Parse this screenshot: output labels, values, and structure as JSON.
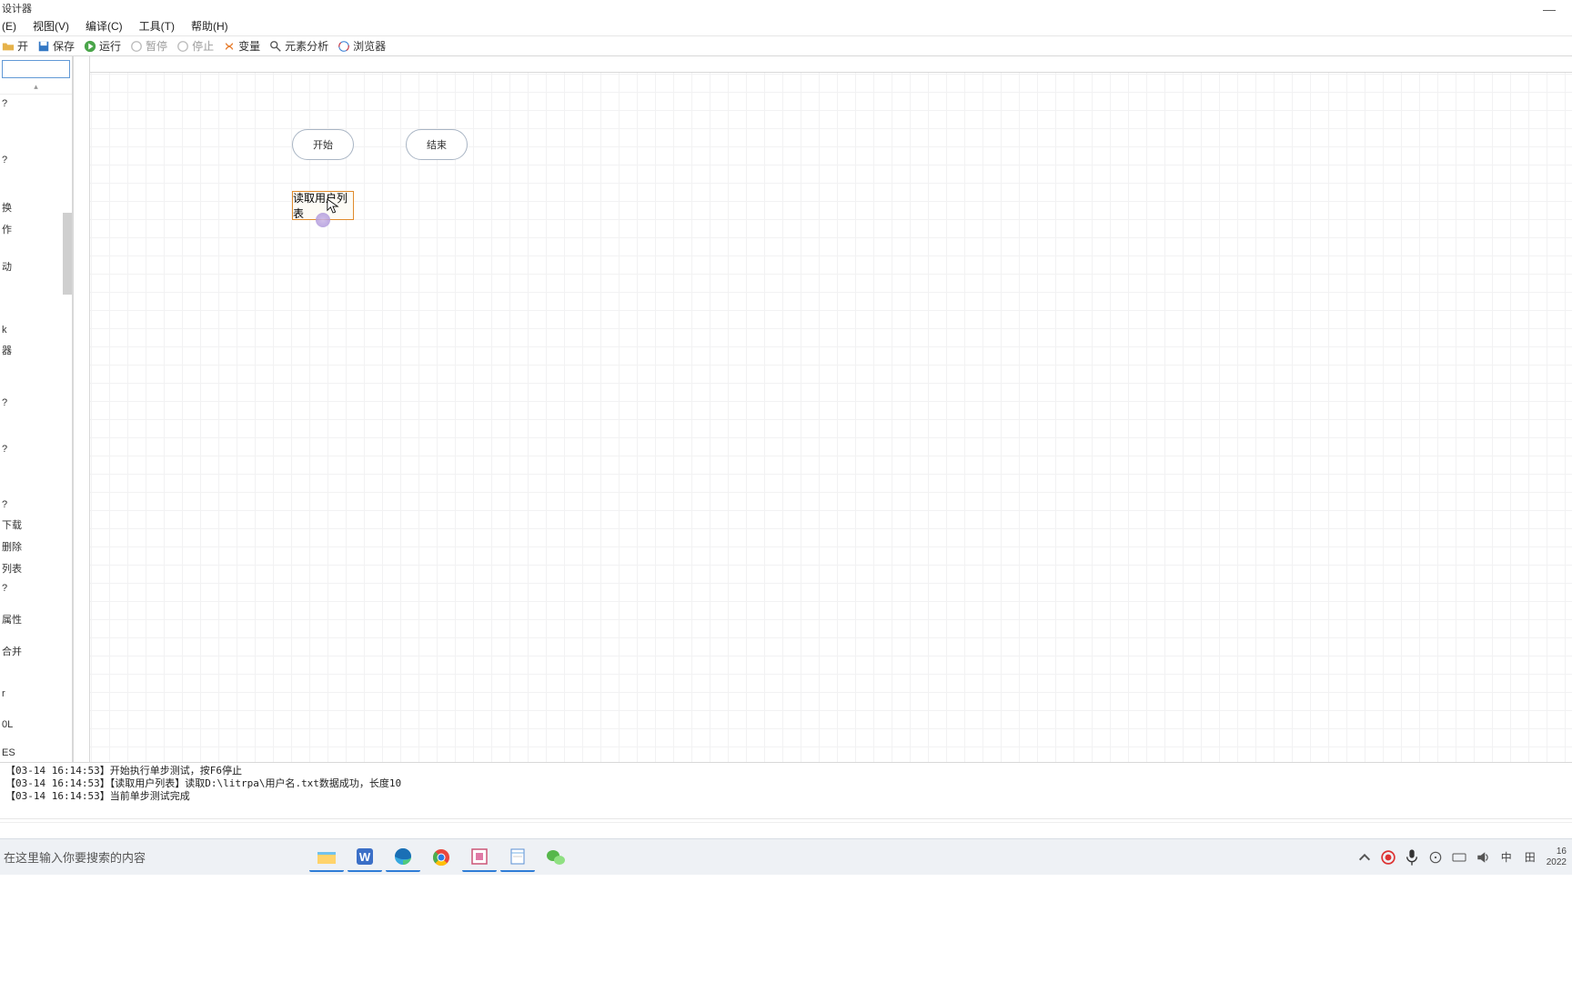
{
  "title": "设计器",
  "highlight_bar": true,
  "menubar": [
    {
      "label": "(E)"
    },
    {
      "label": "视图(V)"
    },
    {
      "label": "编译(C)"
    },
    {
      "label": "工具(T)"
    },
    {
      "label": "帮助(H)"
    }
  ],
  "toolbar": {
    "open": "开",
    "save": "保存",
    "run": "运行",
    "pause": "暂停",
    "stop": "停止",
    "variable": "变量",
    "element": "元素分析",
    "browser": "浏览器"
  },
  "sidebar_items": [
    "?",
    "?",
    "换",
    "作",
    "动",
    "k",
    "器",
    "?",
    "?",
    "?",
    "下载",
    "删除",
    "列表",
    "?",
    "属性",
    "合并",
    "r",
    "0L",
    "ES"
  ],
  "canvas_nodes": {
    "start": "开始",
    "end": "结束",
    "selected": "读取用户列表"
  },
  "log_lines": [
    "【03-14 16:14:53】开始执行单步测试，按F6停止",
    "【03-14 16:14:53】【读取用户列表】读取D:\\litrpa\\用户名.txt数据成功，长度10",
    "【03-14 16:14:53】当前单步测试完成"
  ],
  "search_placeholder": "在这里输入你要搜索的内容",
  "tray": {
    "ime1": "中",
    "ime2": "田",
    "time": "16",
    "date": "2022"
  }
}
